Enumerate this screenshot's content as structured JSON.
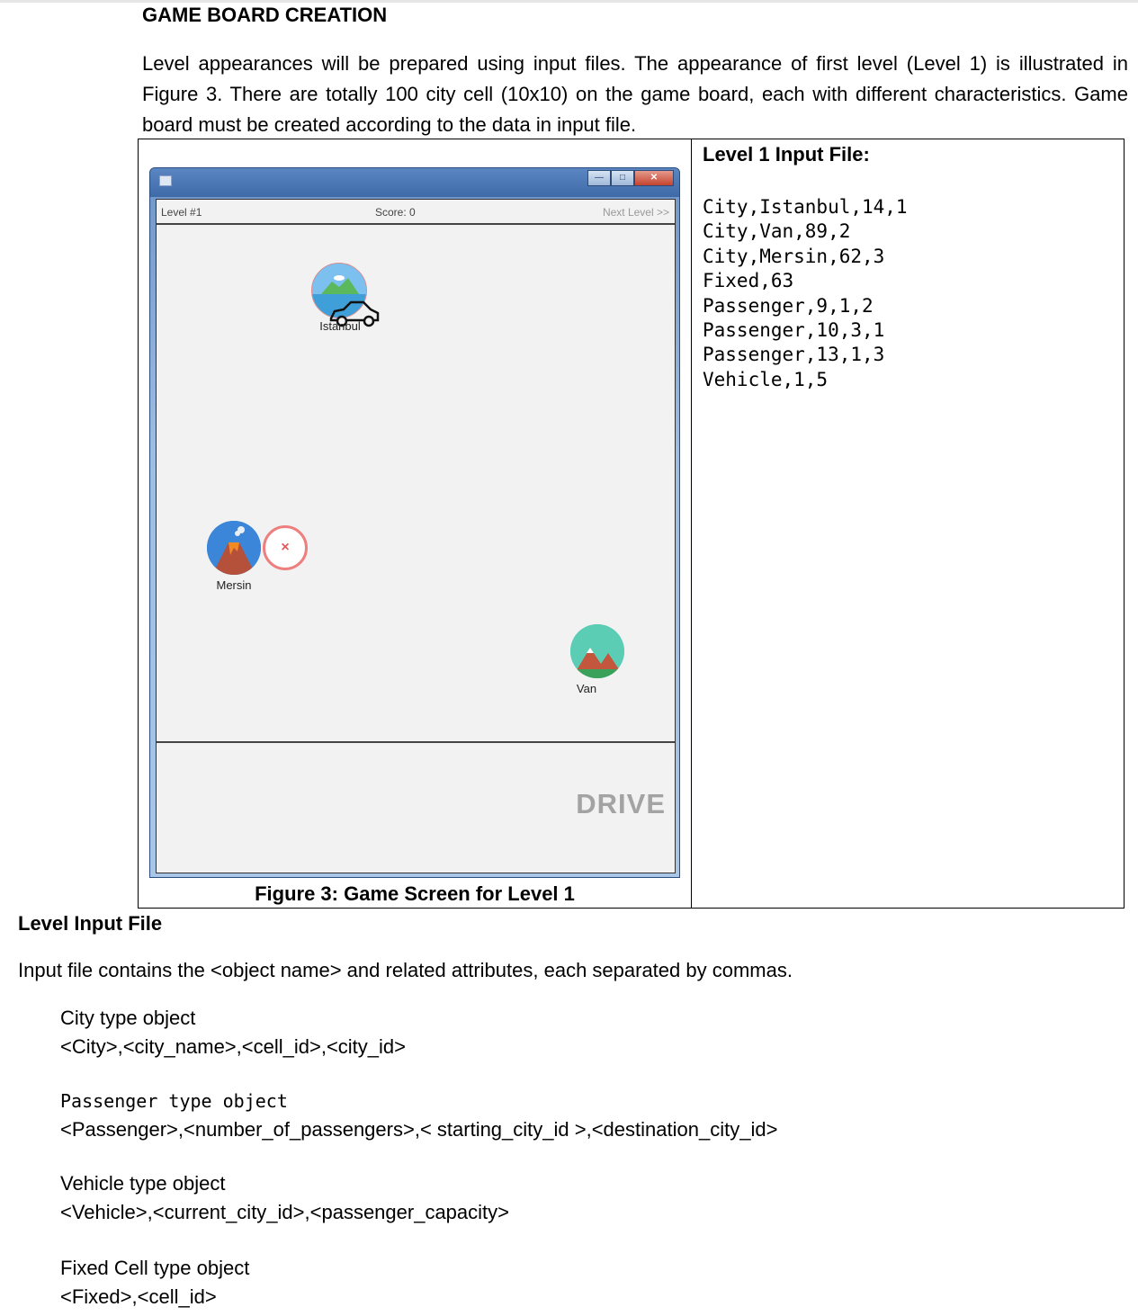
{
  "heading": "GAME BOARD CREATION",
  "intro": "Level appearances will be prepared using input files. The appearance of first level (Level 1) is illustrated in Figure 3. There are totally 100 city cell (10x10) on the game board, each with different characteristics. Game board must be created according to the data in input file.",
  "figure": {
    "caption": "Figure 3: Game Screen for Level 1",
    "window": {
      "status": {
        "level": "Level #1",
        "score": "Score: 0",
        "next": "Next Level >>"
      },
      "cities": [
        "Istanbul",
        "Mersin",
        "Van"
      ],
      "fixed_icon": "×",
      "drive_label": "DRIVE"
    }
  },
  "input_file": {
    "title": "Level 1 Input File:",
    "lines": [
      "City,Istanbul,14,1",
      "City,Van,89,2",
      "City,Mersin,62,3",
      "Fixed,63",
      "Passenger,9,1,2",
      "Passenger,10,3,1",
      "Passenger,13,1,3",
      "Vehicle,1,5"
    ]
  },
  "section": {
    "title": "Level Input File",
    "text": "Input file contains the <object name> and related attributes, each separated by commas.",
    "objects": [
      {
        "name": "City type object",
        "format": "<City>,<city_name>,<cell_id>,<city_id>"
      },
      {
        "name": "Passenger type object",
        "format": "<Passenger>,<number_of_passengers>,< starting_city_id >,<destination_city_id>"
      },
      {
        "name": "Vehicle type object",
        "format": "<Vehicle>,<current_city_id>,<passenger_capacity>"
      },
      {
        "name": "Fixed Cell type object",
        "format": "<Fixed>,<cell_id>"
      }
    ]
  }
}
